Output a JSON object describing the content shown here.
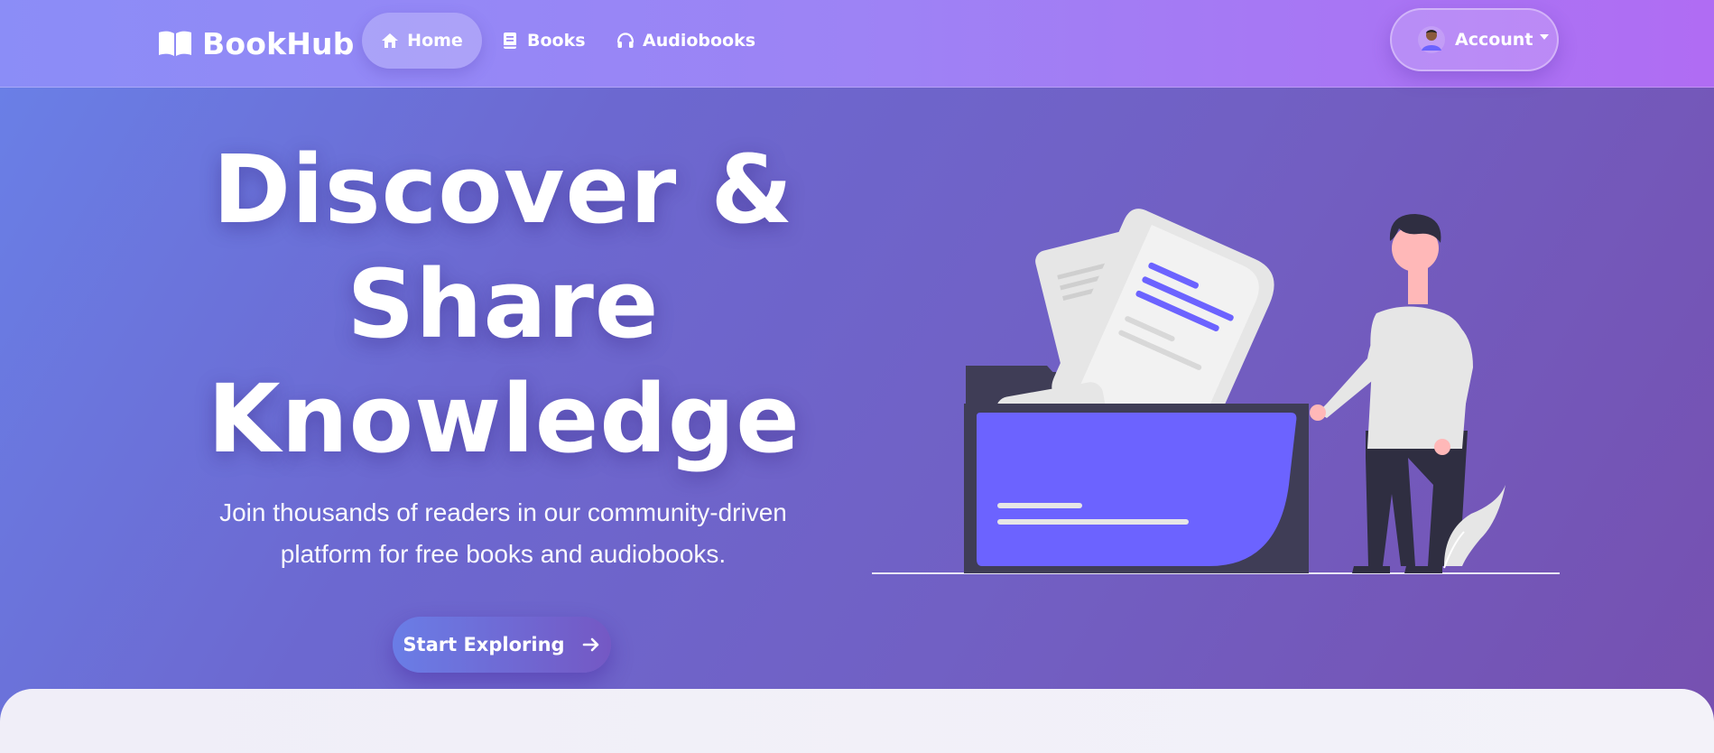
{
  "navbar": {
    "brand": "BookHub",
    "links": [
      {
        "label": "Home",
        "icon": "home-icon",
        "active": true
      },
      {
        "label": "Books",
        "icon": "book-icon",
        "active": false
      },
      {
        "label": "Audiobooks",
        "icon": "headphones-icon",
        "active": false
      }
    ],
    "account_label": "Account"
  },
  "hero": {
    "title_line1": "Discover &",
    "title_line2": "Share",
    "title_line3": "Knowledge",
    "subtitle_line1": "Join thousands of readers in our community-driven",
    "subtitle_line2": "platform for free books and audiobooks.",
    "cta_label": "Start Exploring"
  },
  "colors": {
    "accent": "#6c63ff",
    "nav_gradient_start": "#8b8df7",
    "nav_gradient_end": "#b06cf3",
    "hero_gradient_start": "#6a7fe6",
    "hero_gradient_end": "#7650b0"
  }
}
